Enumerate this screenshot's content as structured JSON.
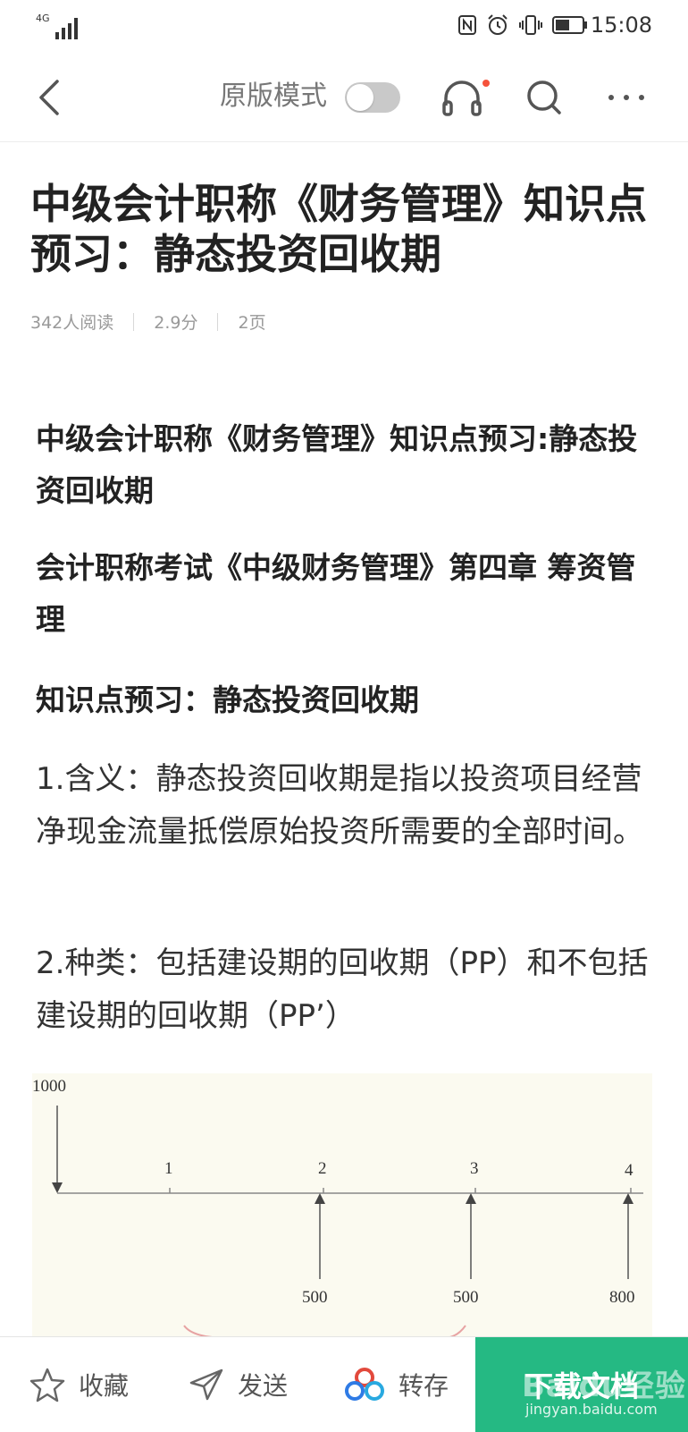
{
  "status_bar": {
    "network": "4G",
    "time": "15:08"
  },
  "toolbar": {
    "mode_label": "原版模式",
    "toggle_on": false,
    "accent_dot_color": "#f5523b"
  },
  "article": {
    "title": "中级会计职称《财务管理》知识点预习：静态投资回收期",
    "meta": {
      "reads": "342人阅读",
      "score": "2.9分",
      "pages": "2页"
    },
    "paragraphs": [
      "中级会计职称《财务管理》知识点预习:静态投资回收期",
      "会计职称考试《中级财务管理》第四章 筹资管理",
      "知识点预习：静态投资回收期",
      "1.含义：静态投资回收期是指以投资项目经营净现金流量抵偿原始投资所需要的全部时间。",
      "2.种类：包括建设期的回收期（PP）和不包括建设期的回收期（PP’）"
    ],
    "figure": {
      "outflow_label": "1000",
      "periods": [
        "1",
        "2",
        "3",
        "4"
      ],
      "inflow_labels": [
        "500",
        "500",
        "800"
      ]
    }
  },
  "bottom_bar": {
    "collect": "收藏",
    "send": "发送",
    "save": "转存",
    "download": "下载文档",
    "accent_color": "#25b983",
    "watermark": "Baidu经验",
    "watermark_url": "jingyan.baidu.com"
  }
}
